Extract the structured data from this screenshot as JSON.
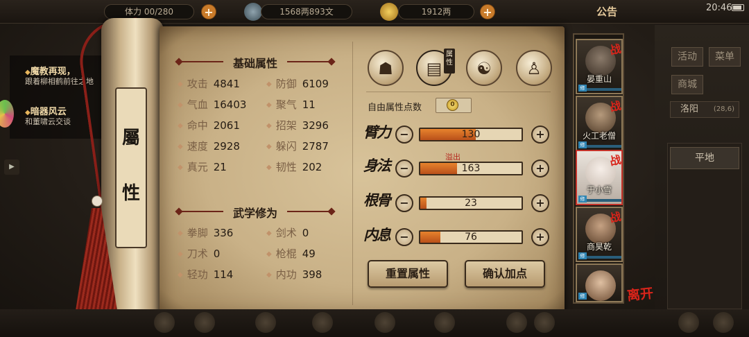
{
  "topbar": {
    "stamina_label": "体力",
    "stamina": "00/280",
    "money": "1568两893文",
    "ingots": "1912两",
    "notice": "公告",
    "time": "20:46"
  },
  "quests": [
    {
      "title": "魔教再现，",
      "desc": "跟着柳相鹤前往之地"
    },
    {
      "title": "暗器风云",
      "desc": "和董啸云交谈"
    }
  ],
  "scroll_tab": {
    "char1": "屬",
    "char2": "性"
  },
  "base_attributes": {
    "title": "基础属性",
    "stats": [
      {
        "label": "攻击",
        "value": "4841"
      },
      {
        "label": "防御",
        "value": "6109"
      },
      {
        "label": "气血",
        "value": "16403"
      },
      {
        "label": "聚气",
        "value": "11"
      },
      {
        "label": "命中",
        "value": "2061"
      },
      {
        "label": "招架",
        "value": "3296"
      },
      {
        "label": "速度",
        "value": "2928"
      },
      {
        "label": "躲闪",
        "value": "2787"
      },
      {
        "label": "真元",
        "value": "21"
      },
      {
        "label": "韧性",
        "value": "202"
      }
    ]
  },
  "martial_arts": {
    "title": "武学修为",
    "stats": [
      {
        "label": "拳脚",
        "value": "336"
      },
      {
        "label": "剑术",
        "value": "0"
      },
      {
        "label": "刀术",
        "value": "0"
      },
      {
        "label": "枪棍",
        "value": "49"
      },
      {
        "label": "轻功",
        "value": "114"
      },
      {
        "label": "内功",
        "value": "398"
      }
    ]
  },
  "tabs": {
    "icons": [
      "hat-portrait-icon",
      "scroll-attributes-icon",
      "bagua-icon",
      "body-meridian-icon"
    ],
    "active_badge": "属性"
  },
  "free_points": {
    "label": "自由属性点数",
    "value": "0"
  },
  "attributes": [
    {
      "name": "臂力",
      "value": "130",
      "fill": 0.55
    },
    {
      "name": "身法",
      "value": "163",
      "fill": 0.36
    },
    {
      "name": "根骨",
      "value": "23",
      "fill": 0.06
    },
    {
      "name": "内息",
      "value": "76",
      "fill": 0.2
    }
  ],
  "overflow_label": "溢出",
  "buttons": {
    "reset": "重置属性",
    "confirm": "确认加点",
    "minus": "−",
    "plus": "+"
  },
  "team": [
    {
      "name": "晏重山",
      "badge": "战"
    },
    {
      "name": "火工老僧",
      "badge": "战"
    },
    {
      "name": "于小雪",
      "badge": "战"
    },
    {
      "name": "商昊乾",
      "badge": "战"
    },
    {
      "name": "",
      "badge": ""
    }
  ],
  "leave_label": "离开",
  "right_menu": {
    "activity": "活动",
    "menu": "菜单",
    "shop": "商城",
    "location": "洛阳",
    "coords": "(28,6)",
    "terrain": "平地"
  },
  "colors": {
    "accent": "#c97b2a",
    "bar_fill": "#d56a22",
    "war": "#d8241a"
  }
}
